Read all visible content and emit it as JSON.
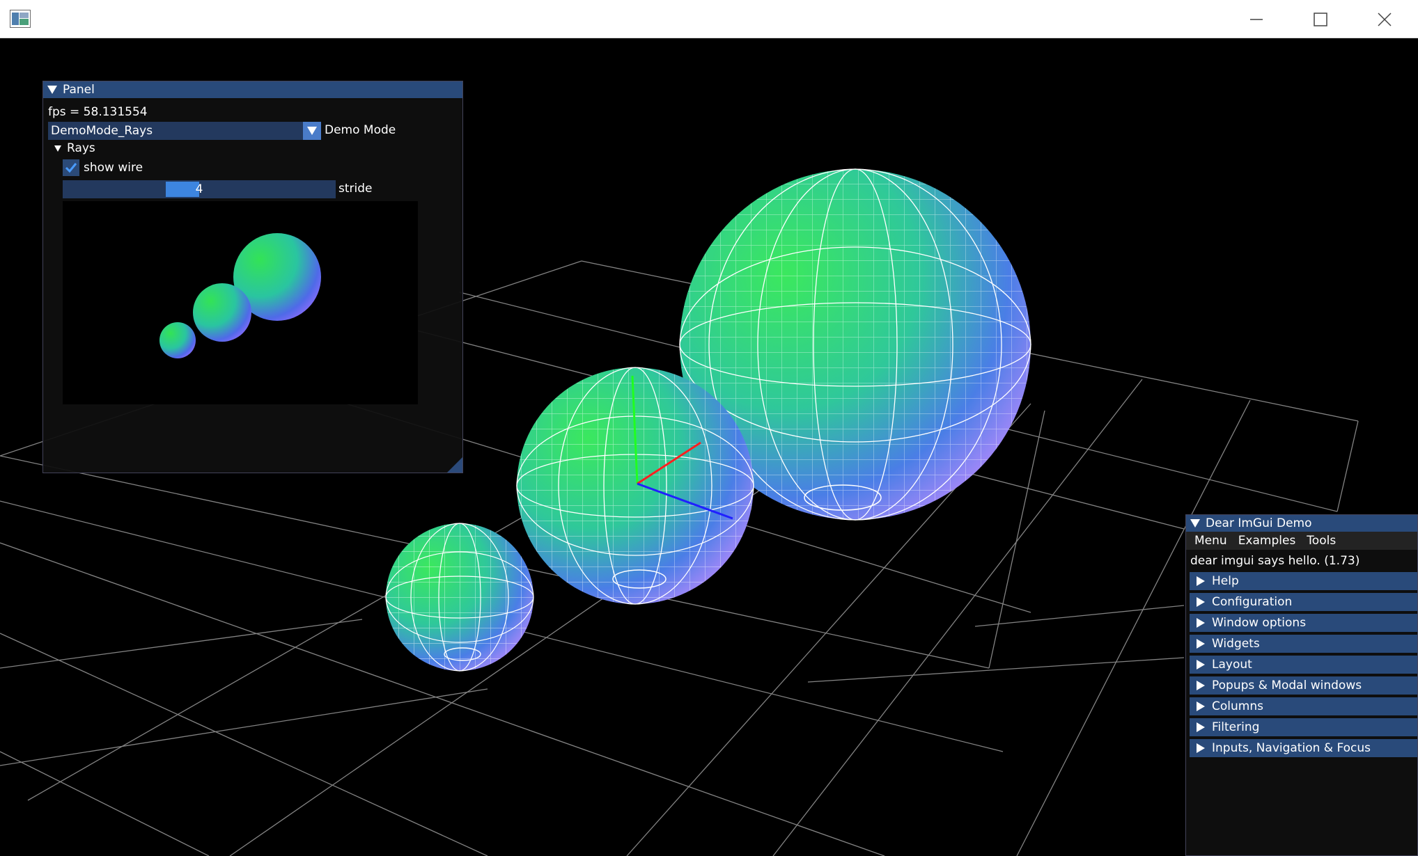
{
  "window": {
    "controls": {
      "minimize_icon": "minimize-icon",
      "maximize_icon": "maximize-icon",
      "close_icon": "close-icon"
    }
  },
  "panel": {
    "title": "Panel",
    "fps_text": "fps = 58.131554",
    "demo_mode_value": "DemoMode_Rays",
    "demo_mode_label": "Demo Mode",
    "rays_header": "Rays",
    "show_wire_label": "show wire",
    "show_wire_checked": true,
    "stride_value": "4",
    "stride_label": "stride"
  },
  "imgui_demo": {
    "title": "Dear ImGui Demo",
    "menus": [
      "Menu",
      "Examples",
      "Tools"
    ],
    "hello_text": "dear imgui says hello. (1.73)",
    "headers": [
      "Help",
      "Configuration",
      "Window options",
      "Widgets",
      "Layout",
      "Popups & Modal windows",
      "Columns",
      "Filtering",
      "Inputs, Navigation & Focus"
    ]
  },
  "colors": {
    "title_active": "#294a7a",
    "frame_bg": "#23395e",
    "slider_grab": "#3d85e0",
    "axis_x": "#ff2020",
    "axis_y": "#20ff20",
    "axis_z": "#2020ff"
  }
}
